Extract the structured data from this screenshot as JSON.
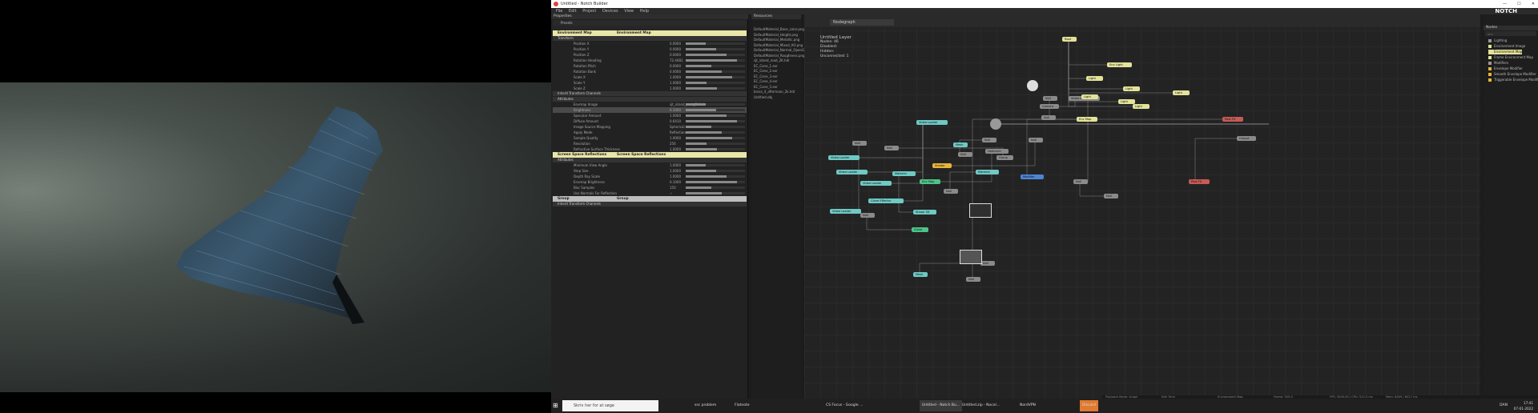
{
  "window": {
    "title": "Untitled - Notch Builder",
    "minimize": "—",
    "maximize": "☐",
    "close": "✕"
  },
  "menu": [
    "File",
    "Edit",
    "Project",
    "Devices",
    "View",
    "Help"
  ],
  "logo": "NOTCH",
  "properties": {
    "title": "Properties",
    "preset_label": "Presets",
    "env_map": {
      "name": "Environment Map",
      "type": "Environment Map"
    },
    "transform_label": "Transform",
    "transform_rows": [
      {
        "name": "Position X",
        "value": "0.0000"
      },
      {
        "name": "Position Y",
        "value": "0.0000"
      },
      {
        "name": "Position Z",
        "value": "0.0000"
      },
      {
        "name": "Rotation Heading",
        "value": "72.4481"
      },
      {
        "name": "Rotation Pitch",
        "value": "0.0000"
      },
      {
        "name": "Rotation Bank",
        "value": "0.0000"
      },
      {
        "name": "Scale X",
        "value": "1.0000"
      },
      {
        "name": "Scale Y",
        "value": "1.0000"
      },
      {
        "name": "Scale Z",
        "value": "1.0000"
      }
    ],
    "inherit_label": "Inherit Transform Channels",
    "attributes_label": "Attributes",
    "attr_rows": [
      {
        "name": "Envmap Image",
        "value": "sjt_island_road_2K.hdr"
      },
      {
        "name": "Brightness",
        "value": "0.1000"
      },
      {
        "name": "Specular Amount",
        "value": "1.0000"
      },
      {
        "name": "Diffuse Amount",
        "value": "0.6410"
      },
      {
        "name": "Image Source Mapping",
        "value": "Spherical"
      },
      {
        "name": "Apply Mode",
        "value": "Reflection"
      },
      {
        "name": "Sample Quality",
        "value": "1.0000"
      },
      {
        "name": "Resolution",
        "value": "256"
      },
      {
        "name": "Refractive Surface Thickness",
        "value": "1.0000"
      },
      {
        "name": "Max Input Brightness",
        "value": "1.0000"
      }
    ],
    "ssr": {
      "name": "Screen Space Reflections",
      "type": "Screen Space Reflections"
    },
    "ssr_attributes_label": "Attributes",
    "ssr_rows": [
      {
        "name": "Minimum View Angle",
        "value": "1.0000"
      },
      {
        "name": "Step Size",
        "value": "1.0000"
      },
      {
        "name": "Depth Ray Scale",
        "value": "1.0000"
      },
      {
        "name": "Envmap Brightness",
        "value": "0.1000"
      },
      {
        "name": "Blur Samples",
        "value": "150"
      },
      {
        "name": "Use Normals For Reflection",
        "value": "✓"
      },
      {
        "name": "Animate Noise",
        "value": "✓"
      }
    ],
    "group": {
      "name": "Group",
      "type": "Group"
    },
    "group_inherit_label": "Inherit Transform Channels"
  },
  "resources": {
    "title": "Resources",
    "items": [
      "DefaultMaterial_Base_color.png",
      "DefaultMaterial_Height.png",
      "DefaultMaterial_Metallic.png",
      "DefaultMaterial_Mixed_AO.png",
      "DefaultMaterial_Normal_OpenGL.png",
      "DefaultMaterial_Roughness.png",
      "sjt_island_road_2K.hdr",
      "EC_Cone_1.exr",
      "EC_Cone_2.exr",
      "EC_Cone_3.exr",
      "EC_Cone_4.exr",
      "EC_Cone_5.exr",
      "brass_4_afternoon_2k.hdr",
      "Untitled.obj"
    ]
  },
  "graph": {
    "tab": "Nodegraph",
    "layer": {
      "title": "Untitled Layer",
      "lines": [
        "Nodes: 46",
        "Disabled:",
        "Hidden:",
        "Unconnected: 1"
      ]
    },
    "nodes": [
      {
        "label": "Root",
        "color": "yel"
      },
      {
        "label": "Env Light",
        "color": "yel"
      },
      {
        "label": "Light",
        "color": "yel"
      },
      {
        "label": "Light",
        "color": "yel"
      },
      {
        "label": "Light",
        "color": "yel"
      },
      {
        "label": "Light",
        "color": "yel"
      },
      {
        "label": "Light",
        "color": "yel"
      },
      {
        "label": "Null",
        "color": "gray"
      },
      {
        "label": "Null",
        "color": "gray"
      },
      {
        "label": "Video Loader",
        "color": "gray"
      },
      {
        "label": "Camera",
        "color": "gray"
      },
      {
        "label": "Video Loader",
        "color": "cyan"
      },
      {
        "label": "Video Loader",
        "color": "cyan"
      },
      {
        "label": "Video Loader",
        "color": "cyan"
      },
      {
        "label": "Video Loader",
        "color": "cyan"
      },
      {
        "label": "Clone Effector",
        "color": "cyan"
      },
      {
        "label": "Material",
        "color": "cyan"
      },
      {
        "label": "Shape 3D",
        "color": "cyan"
      },
      {
        "label": "Mesh",
        "color": "cyan"
      },
      {
        "label": "Null",
        "color": "gray"
      },
      {
        "label": "Null",
        "color": "gray"
      },
      {
        "label": "Deformer",
        "color": "gray"
      },
      {
        "label": "Env Map",
        "color": "green"
      },
      {
        "label": "Null",
        "color": "gray"
      },
      {
        "label": "Material",
        "color": "cyan"
      },
      {
        "label": "Null",
        "color": "gray"
      },
      {
        "label": "Shader",
        "color": "org"
      },
      {
        "label": "Modifier",
        "color": "blue"
      },
      {
        "label": "Post FX",
        "color": "red"
      },
      {
        "label": "Post FX",
        "color": "red"
      },
      {
        "label": "Output",
        "color": "gray"
      },
      {
        "label": "Group",
        "color": "gray"
      },
      {
        "label": "Null",
        "color": "gray"
      },
      {
        "label": "Null",
        "color": "gray"
      },
      {
        "label": "Video Loader",
        "color": "cyan"
      },
      {
        "label": "Null",
        "color": "gray"
      },
      {
        "label": "Clone",
        "color": "green"
      },
      {
        "label": "Mesh",
        "color": "cyan"
      },
      {
        "label": "Null",
        "color": "gray"
      },
      {
        "label": "Null",
        "color": "gray"
      },
      {
        "label": "Env Map",
        "color": "yel"
      },
      {
        "label": "Light",
        "color": "yel"
      },
      {
        "label": "Null",
        "color": "gray"
      },
      {
        "label": "Null",
        "color": "gray"
      }
    ]
  },
  "right_panel": {
    "title": "Nodes",
    "search_placeholder": "env",
    "items": [
      {
        "label": "Lighting",
        "kind": "category"
      },
      {
        "label": "Environment Image",
        "kind": "item"
      },
      {
        "label": "Environment Map",
        "kind": "item"
      },
      {
        "label": "Frame Environment Map",
        "kind": "item"
      },
      {
        "label": "Modifiers",
        "kind": "category"
      },
      {
        "label": "Envelope Modifier",
        "kind": "item"
      },
      {
        "label": "Smooth Envelope Modifier",
        "kind": "item"
      },
      {
        "label": "Triggerable Envelope Modifier",
        "kind": "item"
      }
    ]
  },
  "status": [
    "Playback Mode: Graph",
    "Edit Time",
    "Environment Map",
    "Frame: 925.0",
    "FPS: 5000.00 | CPU: 512.0 ms",
    "Mem: 6409 / 8017 ms"
  ],
  "taskbar": {
    "search_placeholder": "Skriv her for at søge",
    "apps": [
      {
        "label": "ssc problem",
        "active": false
      },
      {
        "label": "Flatnote",
        "active": false
      },
      {
        "label": "CS Focus - Google ...",
        "active": false
      },
      {
        "label": "Untitled - Notch Bu...",
        "active": true
      },
      {
        "label": "Untitled.zip - Nocol...",
        "active": false
      },
      {
        "label": "NordVPN",
        "active": false
      },
      {
        "label": "Discord",
        "active": false
      }
    ],
    "lang": "DAN",
    "time": "17:41",
    "date": "07-01-2022"
  },
  "colors": {
    "yel": "#e3e29a",
    "cyan": "#6fc9c4",
    "gray": "#8a8a8a",
    "org": "#e8b43a",
    "blue": "#4b86d6",
    "red": "#c65a56",
    "green": "#4ec48a",
    "discord": "#e07a30"
  }
}
